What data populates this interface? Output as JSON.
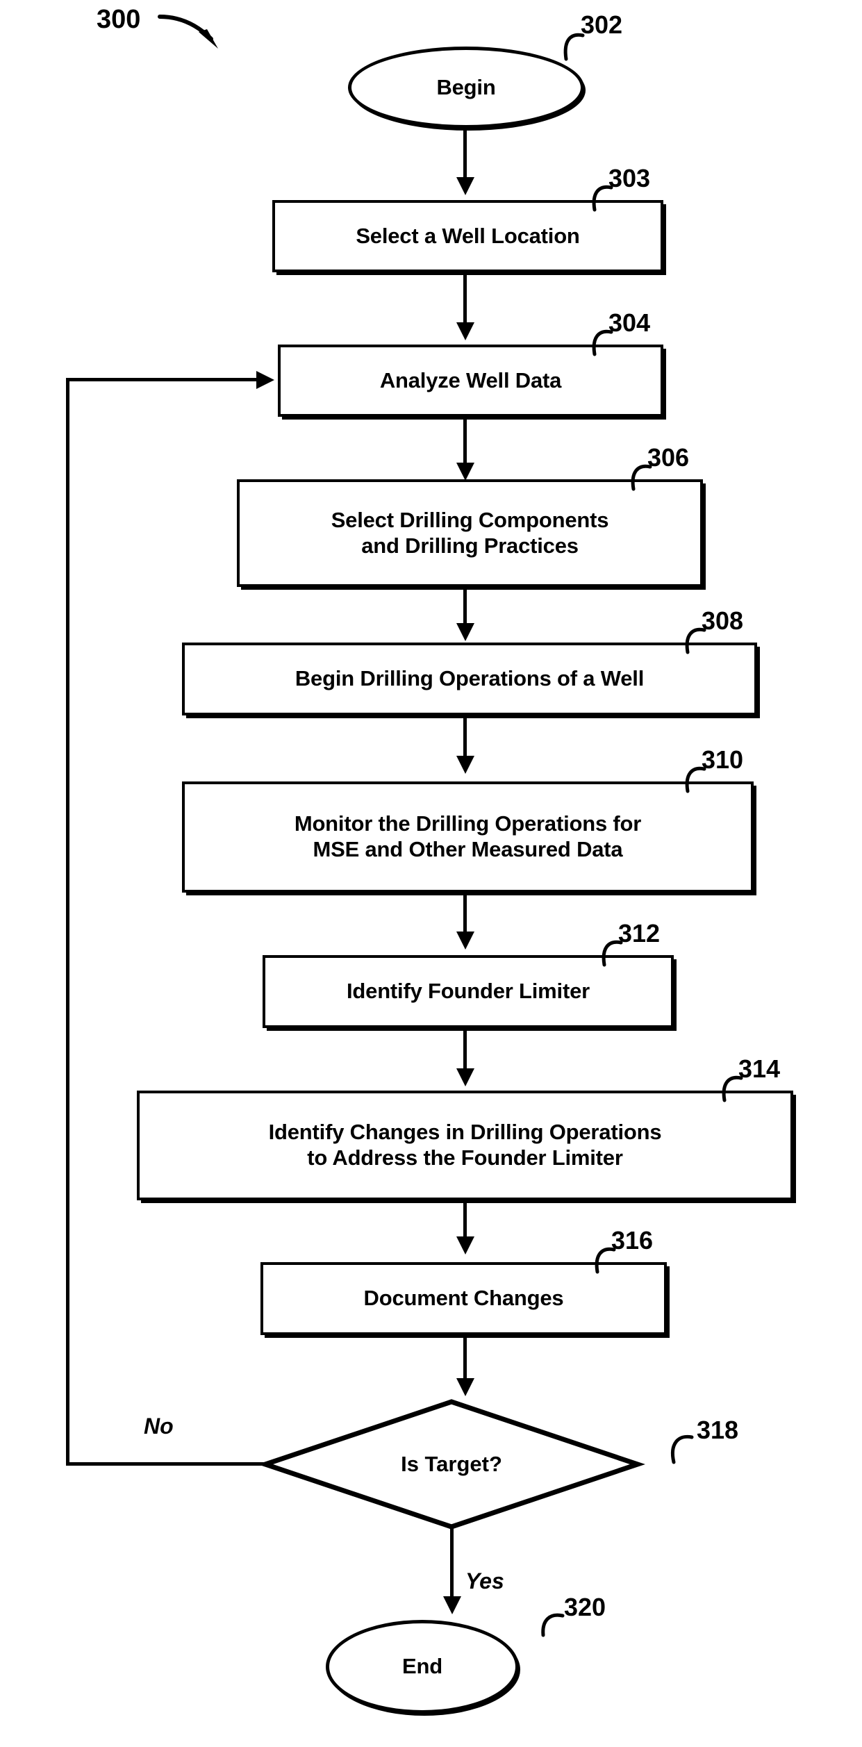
{
  "figure": {
    "number": "300",
    "type": "flowchart",
    "title_label": "300"
  },
  "nodes": [
    {
      "id": "302",
      "ref": "302",
      "shape": "oval",
      "label": "Begin"
    },
    {
      "id": "303",
      "ref": "303",
      "shape": "rect",
      "label": "Select a Well Location"
    },
    {
      "id": "304",
      "ref": "304",
      "shape": "rect",
      "label": "Analyze Well Data"
    },
    {
      "id": "306",
      "ref": "306",
      "shape": "rect",
      "label": "Select Drilling Components and Drilling Practices",
      "line1": "Select Drilling Components",
      "line2": "and Drilling Practices"
    },
    {
      "id": "308",
      "ref": "308",
      "shape": "rect",
      "label": "Begin Drilling Operations of a Well"
    },
    {
      "id": "310",
      "ref": "310",
      "shape": "rect",
      "label": "Monitor the Drilling Operations for MSE and Other Measured Data",
      "line1": "Monitor the Drilling Operations for",
      "line2": "MSE and Other Measured Data"
    },
    {
      "id": "312",
      "ref": "312",
      "shape": "rect",
      "label": "Identify Founder Limiter"
    },
    {
      "id": "314",
      "ref": "314",
      "shape": "rect",
      "label": "Identify Changes in Drilling Operations to Address the Founder Limiter",
      "line1": "Identify Changes in Drilling Operations",
      "line2": "to Address the Founder Limiter"
    },
    {
      "id": "316",
      "ref": "316",
      "shape": "rect",
      "label": "Document Changes"
    },
    {
      "id": "318",
      "ref": "318",
      "shape": "diamond",
      "label": "Is Target?"
    },
    {
      "id": "320",
      "ref": "320",
      "shape": "oval",
      "label": "End"
    }
  ],
  "branches": {
    "no_label": "No",
    "yes_label": "Yes"
  },
  "colors": {
    "stroke": "#000000",
    "fill": "#ffffff",
    "text": "#000000"
  }
}
